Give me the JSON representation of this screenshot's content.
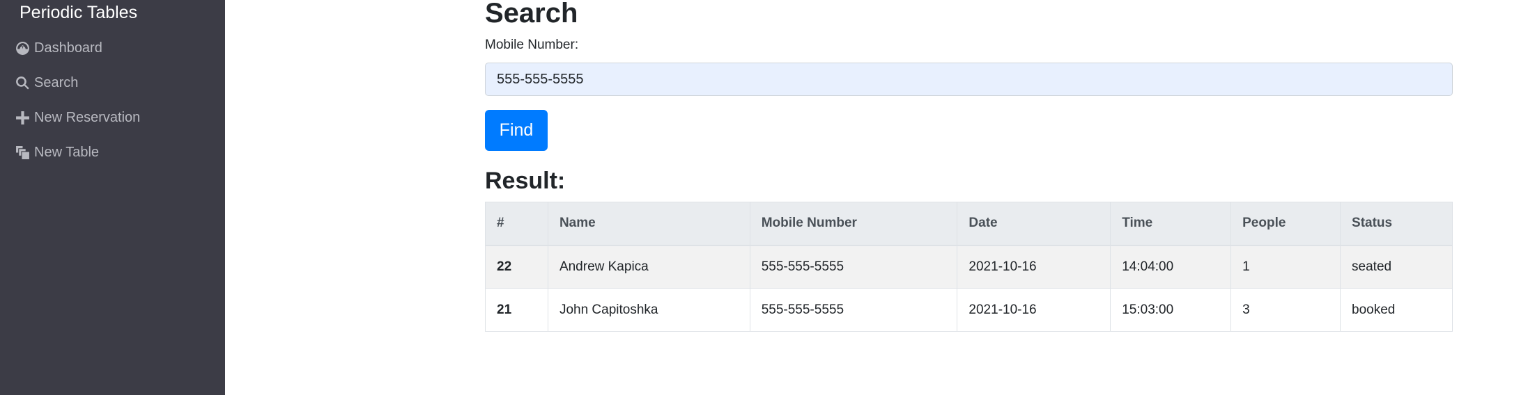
{
  "sidebar": {
    "brand": "Periodic Tables",
    "items": [
      {
        "label": "Dashboard",
        "icon": "dashboard-icon"
      },
      {
        "label": "Search",
        "icon": "search-icon"
      },
      {
        "label": "New Reservation",
        "icon": "plus-icon"
      },
      {
        "label": "New Table",
        "icon": "layers-icon"
      }
    ]
  },
  "search": {
    "title": "Search",
    "field_label": "Mobile Number:",
    "value": "555-555-5555",
    "button_label": "Find"
  },
  "result": {
    "title": "Result:",
    "columns": [
      "#",
      "Name",
      "Mobile Number",
      "Date",
      "Time",
      "People",
      "Status"
    ],
    "rows": [
      {
        "id": "22",
        "name": "Andrew Kapica",
        "mobile": "555-555-5555",
        "date": "2021-10-16",
        "time": "14:04:00",
        "people": "1",
        "status": "seated"
      },
      {
        "id": "21",
        "name": "John Capitoshka",
        "mobile": "555-555-5555",
        "date": "2021-10-16",
        "time": "15:03:00",
        "people": "3",
        "status": "booked"
      }
    ]
  },
  "colors": {
    "sidebar_bg": "#3c3c46",
    "primary": "#007bff",
    "input_bg": "#e8f0fe"
  }
}
